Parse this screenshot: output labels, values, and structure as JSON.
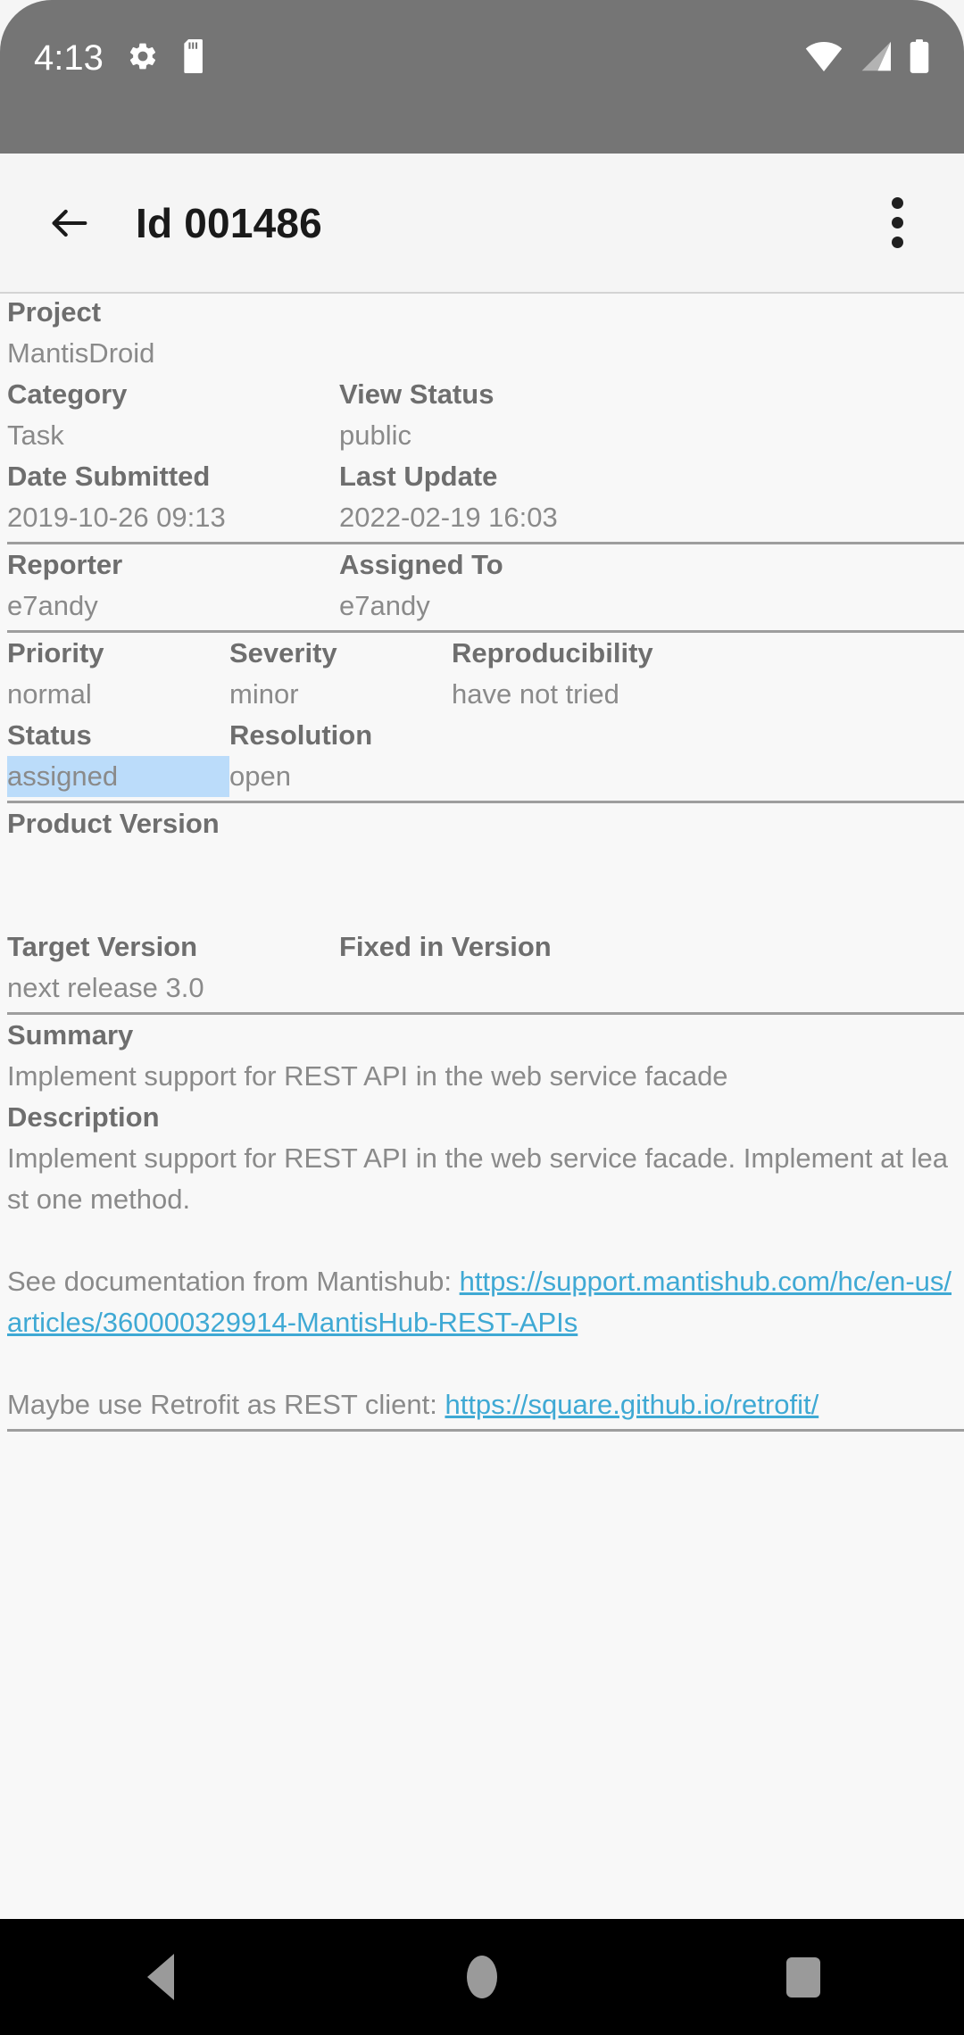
{
  "statusbar": {
    "time": "4:13",
    "icons": [
      "gear-icon",
      "sd-card-icon",
      "wifi-icon",
      "cellular-signal-icon",
      "battery-icon"
    ]
  },
  "appbar": {
    "back_label": "back-arrow",
    "title": "Id 001486",
    "overflow_label": "more-options"
  },
  "colors": {
    "status_bar_bg": "#757575",
    "content_bg": "#f8f8f8",
    "label": "#6e6e6e",
    "value": "#8a8a8a",
    "link": "#3fa9d4",
    "highlight": "#bbdcfa",
    "divider": "#9e9e9e",
    "nav_bar_bg": "#000000"
  },
  "issue": {
    "project": {
      "label": "Project",
      "value": "MantisDroid"
    },
    "category": {
      "label": "Category",
      "value": "Task"
    },
    "view_status": {
      "label": "View Status",
      "value": "public"
    },
    "date_submitted": {
      "label": "Date Submitted",
      "value": "2019-10-26 09:13"
    },
    "last_update": {
      "label": "Last Update",
      "value": "2022-02-19 16:03"
    },
    "reporter": {
      "label": "Reporter",
      "value": "e7andy"
    },
    "assigned_to": {
      "label": "Assigned To",
      "value": "e7andy"
    },
    "priority": {
      "label": "Priority",
      "value": "normal"
    },
    "severity": {
      "label": "Severity",
      "value": "minor"
    },
    "reproducibility": {
      "label": "Reproducibility",
      "value": "have not tried"
    },
    "status": {
      "label": "Status",
      "value": "assigned"
    },
    "resolution": {
      "label": "Resolution",
      "value": "open"
    },
    "product_version": {
      "label": "Product Version",
      "value": ""
    },
    "target_version": {
      "label": "Target Version",
      "value": "next release 3.0"
    },
    "fixed_in_version": {
      "label": "Fixed in Version",
      "value": ""
    },
    "summary": {
      "label": "Summary",
      "value": "Implement support for REST API in the web service facade"
    },
    "description": {
      "label": "Description",
      "para1": "Implement support for REST API in the web service facade. Implement at least one method.",
      "para2_prefix": "See documentation from Mantishub: ",
      "para2_link": "https://support.mantishub.com/hc/en-us/articles/360000329914-MantisHub-REST-APIs",
      "para3_prefix": "Maybe use Retrofit as REST client: ",
      "para3_link": "https://square.github.io/retrofit/"
    }
  },
  "navbar": {
    "back_label": "back",
    "home_label": "home",
    "recents_label": "recent-apps"
  }
}
